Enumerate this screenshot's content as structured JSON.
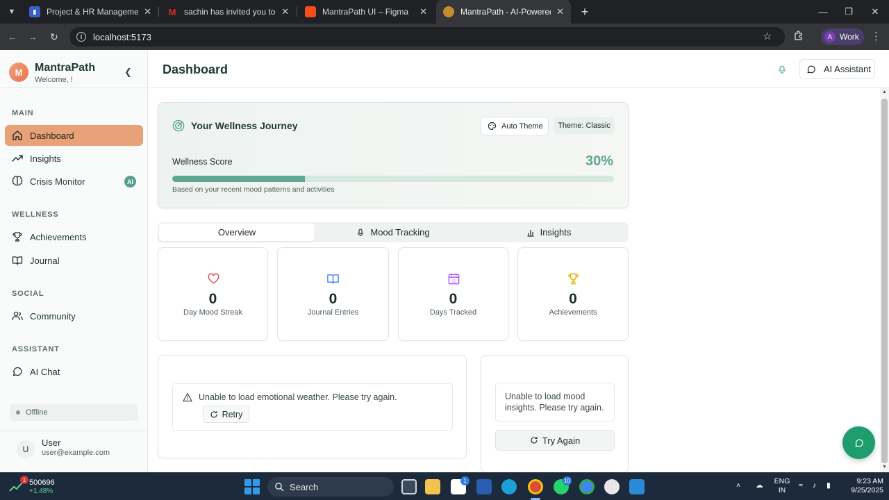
{
  "browser": {
    "tabs": [
      {
        "title": "Project & HR Management Syst",
        "favicon_color": "#3a62c4"
      },
      {
        "title": "sachin has invited you to join th",
        "favicon_color": "#d93025"
      },
      {
        "title": "MantraPath UI – Figma",
        "favicon_color": "#f24e1e"
      },
      {
        "title": "MantraPath - AI-Powered Welln",
        "favicon_color": "#c58b2c"
      }
    ],
    "active_tab": 3,
    "url": "localhost:5173",
    "profile": {
      "initial": "A",
      "name": "Work"
    }
  },
  "sidebar": {
    "brand": {
      "logo_letter": "M",
      "name": "MantraPath",
      "welcome": "Welcome, !"
    },
    "sections": {
      "main": "MAIN",
      "wellness": "WELLNESS",
      "social": "SOCIAL",
      "assistant": "ASSISTANT"
    },
    "items": {
      "dashboard": "Dashboard",
      "insights": "Insights",
      "crisis": "Crisis Monitor",
      "crisis_badge": "AI",
      "achievements": "Achievements",
      "journal": "Journal",
      "community": "Community",
      "ai_chat": "AI Chat"
    },
    "status": "Offline",
    "user": {
      "initial": "U",
      "name": "User",
      "email": "user@example.com"
    }
  },
  "header": {
    "title": "Dashboard",
    "ai_assistant": "AI Assistant"
  },
  "journey": {
    "title": "Your Wellness Journey",
    "auto_theme": "Auto Theme",
    "theme_badge": "Theme: Classic",
    "score_label": "Wellness Score",
    "score_value": "30%",
    "score_fraction": 0.3,
    "note": "Based on your recent mood patterns and activities"
  },
  "tabs": {
    "overview": "Overview",
    "mood": "Mood Tracking",
    "insights": "Insights"
  },
  "stats": [
    {
      "value": "0",
      "label": "Day Mood Streak",
      "icon": "heart-icon",
      "color": "#e5484d"
    },
    {
      "value": "0",
      "label": "Journal Entries",
      "icon": "book-icon",
      "color": "#3b82f6"
    },
    {
      "value": "0",
      "label": "Days Tracked",
      "icon": "calendar-icon",
      "color": "#a855f7"
    },
    {
      "value": "0",
      "label": "Achievements",
      "icon": "trophy-icon",
      "color": "#eab308"
    }
  ],
  "weather": {
    "error": "Unable to load emotional weather. Please try again.",
    "retry": "Retry"
  },
  "mood_insights": {
    "error": "Unable to load mood insights. Please try again.",
    "try_again": "Try Again"
  },
  "colors": {
    "accent": "#e9a178",
    "primary": "#5fa792",
    "fab": "#1f9d6e"
  },
  "taskbar": {
    "stock_value": "500696",
    "stock_change": "+1.48%",
    "stock_badge": "1",
    "search": "Search",
    "store_badge": "1",
    "whatsapp_badge": "10",
    "lang_1": "ENG",
    "lang_2": "IN",
    "time": "9:23 AM",
    "date": "9/25/2025"
  }
}
